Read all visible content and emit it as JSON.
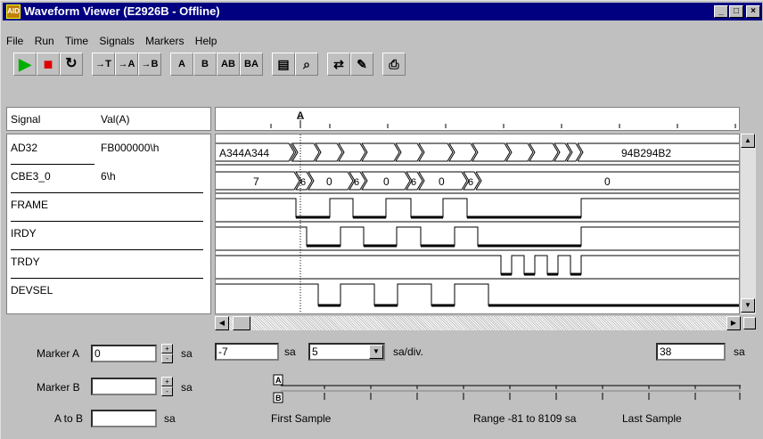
{
  "window": {
    "title": "Waveform Viewer (E2926B - Offline)",
    "app_icon": "AID"
  },
  "title_buttons": {
    "minimize": "_",
    "maximize": "□",
    "close": "×"
  },
  "menu": [
    "File",
    "Run",
    "Time",
    "Signals",
    "Markers",
    "Help"
  ],
  "toolbar": {
    "buttons": [
      {
        "name": "run-icon",
        "label": "▶"
      },
      {
        "name": "stop-icon",
        "label": "■"
      },
      {
        "name": "rerun-icon",
        "label": "↻"
      },
      {
        "name": "goto-trigger-icon",
        "label": "→T"
      },
      {
        "name": "goto-marker-a-icon",
        "label": "→A"
      },
      {
        "name": "goto-marker-b-icon",
        "label": "→B"
      },
      {
        "name": "marker-a-icon",
        "label": "A"
      },
      {
        "name": "marker-b-icon",
        "label": "B"
      },
      {
        "name": "marker-ab-icon",
        "label": "AB"
      },
      {
        "name": "swap-marker-icon",
        "label": "BA"
      },
      {
        "name": "signal-list-icon",
        "label": "▤"
      },
      {
        "name": "find-icon",
        "label": "⌕"
      },
      {
        "name": "compare-icon",
        "label": "⇄"
      },
      {
        "name": "edit-icon",
        "label": "✎"
      },
      {
        "name": "print-icon",
        "label": "⎙"
      }
    ]
  },
  "signal_header": {
    "col_signal": "Signal",
    "col_value": "Val(A)"
  },
  "signals": [
    {
      "name": "AD32",
      "value": "FB000000\\h"
    },
    {
      "name": "CBE3_0",
      "value": "6\\h"
    },
    {
      "name": "FRAME",
      "value": ""
    },
    {
      "name": "IRDY",
      "value": ""
    },
    {
      "name": "TRDY",
      "value": ""
    },
    {
      "name": "DEVSEL",
      "value": ""
    }
  ],
  "wave_labels": {
    "ad32_left": "A344A344",
    "ad32_right": "94B294B2",
    "cbe_left": "7",
    "cbe_6a": "6",
    "cbe_0a": "0",
    "cbe_6b": "6",
    "cbe_0b": "0",
    "cbe_6c": "6",
    "cbe_0c": "0",
    "cbe_6d": "6",
    "cbe_right": "0",
    "marker_a": "A"
  },
  "controls": {
    "marker_a_label": "Marker A",
    "marker_a_value": "0",
    "marker_b_label": "Marker B",
    "marker_b_value": "",
    "a_to_b_label": "A to B",
    "a_to_b_value": "",
    "unit_sa": "sa",
    "offset_value": "-7",
    "sa_per_div": "5",
    "sa_div_label": "sa/div.",
    "right_value": "38",
    "first_sample": "First Sample",
    "range_text": "Range -81 to 8109 sa",
    "last_sample": "Last Sample",
    "overview_a": "A",
    "overview_b": "B"
  }
}
